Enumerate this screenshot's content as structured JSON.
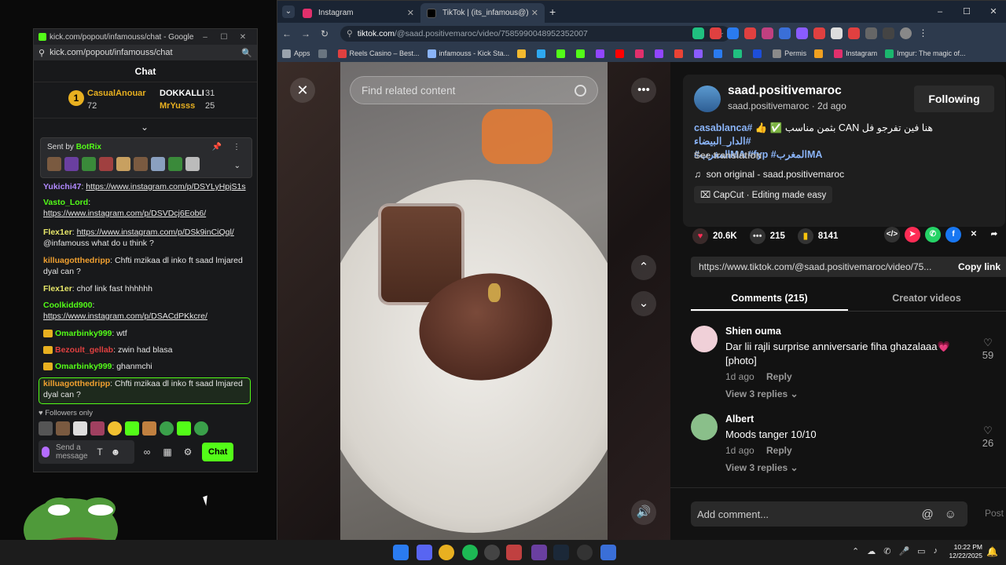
{
  "kick_window": {
    "title": "kick.com/popout/infamouss/chat - Google Chro...",
    "url": "kick.com/popout/infamouss/chat",
    "chat_title": "Chat",
    "leaders": {
      "rank": "1",
      "first": {
        "name": "CasualAnouar",
        "count": "72"
      },
      "second": {
        "name": "DOKKALLI",
        "count": "31"
      },
      "third": {
        "name": "MrYusss",
        "count": "25"
      }
    },
    "pinned": {
      "sent_by": "Sent by",
      "bot": "BotRix"
    },
    "messages": [
      {
        "user": "Yukichi47",
        "text": "https://www.instagram.com/p/DSYLyHpjS1s",
        "color": "#b189ff"
      },
      {
        "user": "Vasto_Lord",
        "text": "https://www.instagram.com/p/DSVDcj6Eob6/",
        "color": "#53fc18"
      },
      {
        "user": "Flex1er",
        "text": "https://www.instagram.com/p/DSk9inCiQql/",
        "text2": "@infamouss what do u think ?",
        "color": "#e8e86a"
      },
      {
        "user": "killuagotthedripp",
        "text": "Chfti mzikaa dl inko ft saad lmjared dyal can ?",
        "color": "#f0a030"
      },
      {
        "user": "Flex1er",
        "text": "chof link fast hhhhhh",
        "color": "#e8e86a"
      },
      {
        "user": "Coolkidd900",
        "text": "https://www.instagram.com/p/DSACdPKkcre/",
        "color": "#53fc18"
      },
      {
        "user": "Omarbinky999",
        "text": "wtf",
        "color": "#53fc18"
      },
      {
        "user": "Bezoult_gellab",
        "text": "zwin had blasa",
        "color": "#e04040"
      },
      {
        "user": "Omarbinky999",
        "text": "ghanmchi",
        "color": "#53fc18"
      },
      {
        "user": "killuagotthedripp",
        "text": "Chfti mzikaa dl inko ft saad lmjared dyal can ?",
        "color": "#f0a030"
      }
    ],
    "followers_only": "Followers only",
    "send_placeholder": "Send a message",
    "chat_button": "Chat"
  },
  "chrome": {
    "tabs": [
      {
        "title": "Instagram",
        "color": "#e1306c"
      },
      {
        "title": "TikTok | (its_infamous@) كريم",
        "color": "#000000"
      }
    ],
    "url_domain": "tiktok.com",
    "url_path": "/@saad.positivemaroc/video/7585990048952352007",
    "bookmarks": [
      {
        "label": "Apps",
        "color": "#9aa3ad"
      },
      {
        "label": "",
        "color": "#6a7580"
      },
      {
        "label": "Reels Casino – Best...",
        "color": "#e04040"
      },
      {
        "label": "infamouss - Kick Sta...",
        "color": "#8ab4f8"
      },
      {
        "label": "",
        "color": "#f3ba2f"
      },
      {
        "label": "",
        "color": "#2ea8f0"
      },
      {
        "label": "",
        "color": "#53fc18"
      },
      {
        "label": "",
        "color": "#53fc18"
      },
      {
        "label": "",
        "color": "#9146ff"
      },
      {
        "label": "",
        "color": "#ff0000"
      },
      {
        "label": "",
        "color": "#e1306c"
      },
      {
        "label": "",
        "color": "#9146ff"
      },
      {
        "label": "",
        "color": "#ea4335"
      },
      {
        "label": "",
        "color": "#8a5cff"
      },
      {
        "label": "",
        "color": "#2a7bf0"
      },
      {
        "label": "",
        "color": "#20c080"
      },
      {
        "label": "",
        "color": "#1d4ed8"
      },
      {
        "label": "Permis",
        "color": "#8a8a8a"
      },
      {
        "label": "",
        "color": "#f0a020"
      },
      {
        "label": "Instagram",
        "color": "#e1306c"
      },
      {
        "label": "Imgur: The magic of...",
        "color": "#1bb76e"
      }
    ]
  },
  "tiktok": {
    "search_placeholder": "Find related content",
    "username": "saad.positivemaroc",
    "sub": "saad.positivemaroc · 2d ago",
    "follow_label": "Following",
    "description": "هنا فين تفرجو فل CAN بثمن مناسب ✅ 👍",
    "tags_line1": "#casablanca #الدار_البيضاء",
    "tags_line2": "#المغربMA #fyp #المغربMA",
    "see_translation": "See translation",
    "music": "son original - saad.positivemaroc",
    "capcut": "CapCut · Editing made easy",
    "likes": "20.6K",
    "comments_count": "215",
    "saves": "8141",
    "link": "https://www.tiktok.com/@saad.positivemaroc/video/75...",
    "copy_link": "Copy link",
    "tab_comments": "Comments (215)",
    "tab_creator": "Creator videos",
    "comments": [
      {
        "name": "Shien ouma",
        "text": "Dar lii rajli surprise anniversarie fiha ghazalaaa💗 [photo]",
        "time": "1d ago",
        "reply": "Reply",
        "likes": "59",
        "replies": "View 3 replies"
      },
      {
        "name": "Albert",
        "text": "Moods tanger 10/10",
        "time": "1d ago",
        "reply": "Reply",
        "likes": "26",
        "replies": "View 3 replies"
      }
    ],
    "add_comment": "Add comment...",
    "post": "Post"
  },
  "taskbar": {
    "time": "10:22 PM",
    "date": "12/22/2025"
  }
}
